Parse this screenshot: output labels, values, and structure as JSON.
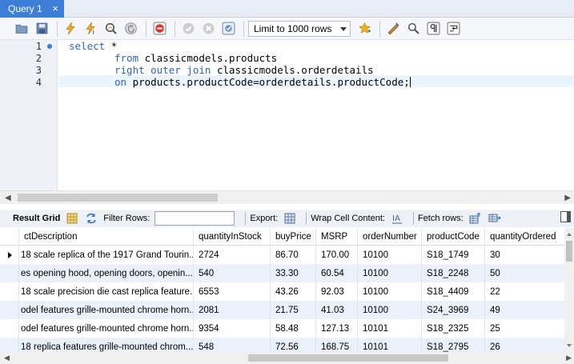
{
  "tab": {
    "title": "Query 1",
    "close": "×"
  },
  "toolbar": {
    "limit_value": "Limit to 1000 rows",
    "icons": [
      "folder-icon",
      "save-icon",
      "execute-icon",
      "execute-current-icon",
      "explain-icon",
      "stop-icon",
      "toggle-autocommit-icon",
      "commit-icon",
      "rollback-icon",
      "toggle-error-icon",
      "bookmark-star-icon",
      "beautify-icon",
      "find-icon",
      "invisible-chars-icon",
      "wrap-icon"
    ]
  },
  "editor": {
    "line_numbers": [
      "1",
      "2",
      "3",
      "4"
    ],
    "lines": [
      {
        "kw": "select",
        "rest": " *"
      },
      {
        "kw": "from",
        "rest": " classicmodels.products"
      },
      {
        "kw": "right outer join",
        "rest": " classicmodels.orderdetails"
      },
      {
        "kw": "on",
        "rest": " products.productCode=orderdetails.productCode;"
      }
    ]
  },
  "result_toolbar": {
    "result_grid": "Result Grid",
    "filter_rows": "Filter Rows:",
    "filter_value": "",
    "export": "Export:",
    "wrap_cell": "Wrap Cell Content:",
    "fetch_rows": "Fetch rows:"
  },
  "grid": {
    "columns": [
      "ctDescription",
      "quantityInStock",
      "buyPrice",
      "MSRP",
      "orderNumber",
      "productCode",
      "quantityOrdered"
    ],
    "rows": [
      [
        "18 scale replica of the 1917 Grand Tourin...",
        "2724",
        "86.70",
        "170.00",
        "10100",
        "S18_1749",
        "30"
      ],
      [
        "es opening hood, opening doors, openin...",
        "540",
        "33.30",
        "60.54",
        "10100",
        "S18_2248",
        "50"
      ],
      [
        "18 scale precision die cast replica feature...",
        "6553",
        "43.26",
        "92.03",
        "10100",
        "S18_4409",
        "22"
      ],
      [
        "odel features grille-mounted chrome horn...",
        "2081",
        "21.75",
        "41.03",
        "10100",
        "S24_3969",
        "49"
      ],
      [
        "odel features grille-mounted chrome horn...",
        "9354",
        "58.48",
        "127.13",
        "10101",
        "S18_2325",
        "25"
      ],
      [
        "18 replica features grille-mounted chrom...",
        "548",
        "72.56",
        "168.75",
        "10101",
        "S18_2795",
        "26"
      ]
    ]
  },
  "colors": {
    "tab_active": "#3d7fd8",
    "keyword": "#2c5fd1",
    "row_alt": "#eaf1fb"
  }
}
